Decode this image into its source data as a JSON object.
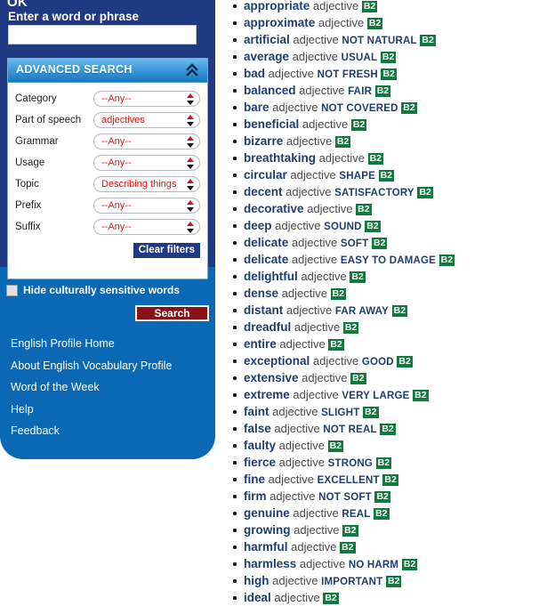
{
  "sidebar": {
    "ok_text": "OK",
    "search_label": "Enter a word or phrase",
    "word_input_value": "",
    "word_input_placeholder": "",
    "advanced_search": {
      "title": "ADVANCED SEARCH",
      "collapse_icon": "double-chevron-up-icon",
      "filters": [
        {
          "label": "Category",
          "value": "--Any--"
        },
        {
          "label": "Part of speech",
          "value": "adjectives"
        },
        {
          "label": "Grammar",
          "value": "--Any--"
        },
        {
          "label": "Usage",
          "value": "--Any--"
        },
        {
          "label": "Topic",
          "value": "Describing things"
        },
        {
          "label": "Prefix",
          "value": "--Any--"
        },
        {
          "label": "Suffix",
          "value": "--Any--"
        }
      ],
      "clear_filters_label": "Clear filters"
    },
    "hide_sensitive_label": "Hide culturally sensitive words",
    "hide_sensitive_checked": false,
    "search_button_label": "Search",
    "nav_links": [
      "English Profile Home",
      "About English Vocabulary Profile",
      "Word of the Week",
      "Help",
      "Feedback"
    ]
  },
  "colors": {
    "sidebar_top": "#1f3a82",
    "sidebar_bottom": "#0a68b4",
    "level_badge_green": "#11793d",
    "search_button_red": "#8b1116",
    "select_text_red": "#ee1111",
    "word_navy": "#1f3d70"
  },
  "results": {
    "entries": [
      {
        "word": "appropriate",
        "pos": "adjective",
        "sense": "",
        "level": "B2"
      },
      {
        "word": "approximate",
        "pos": "adjective",
        "sense": "",
        "level": "B2"
      },
      {
        "word": "artificial",
        "pos": "adjective",
        "sense": "NOT NATURAL",
        "level": "B2"
      },
      {
        "word": "average",
        "pos": "adjective",
        "sense": "USUAL",
        "level": "B2"
      },
      {
        "word": "bad",
        "pos": "adjective",
        "sense": "NOT FRESH",
        "level": "B2"
      },
      {
        "word": "balanced",
        "pos": "adjective",
        "sense": "FAIR",
        "level": "B2"
      },
      {
        "word": "bare",
        "pos": "adjective",
        "sense": "NOT COVERED",
        "level": "B2"
      },
      {
        "word": "beneficial",
        "pos": "adjective",
        "sense": "",
        "level": "B2"
      },
      {
        "word": "bizarre",
        "pos": "adjective",
        "sense": "",
        "level": "B2"
      },
      {
        "word": "breathtaking",
        "pos": "adjective",
        "sense": "",
        "level": "B2"
      },
      {
        "word": "circular",
        "pos": "adjective",
        "sense": "SHAPE",
        "level": "B2"
      },
      {
        "word": "decent",
        "pos": "adjective",
        "sense": "SATISFACTORY",
        "level": "B2"
      },
      {
        "word": "decorative",
        "pos": "adjective",
        "sense": "",
        "level": "B2"
      },
      {
        "word": "deep",
        "pos": "adjective",
        "sense": "SOUND",
        "level": "B2"
      },
      {
        "word": "delicate",
        "pos": "adjective",
        "sense": "SOFT",
        "level": "B2"
      },
      {
        "word": "delicate",
        "pos": "adjective",
        "sense": "EASY TO DAMAGE",
        "level": "B2"
      },
      {
        "word": "delightful",
        "pos": "adjective",
        "sense": "",
        "level": "B2"
      },
      {
        "word": "dense",
        "pos": "adjective",
        "sense": "",
        "level": "B2"
      },
      {
        "word": "distant",
        "pos": "adjective",
        "sense": "FAR AWAY",
        "level": "B2"
      },
      {
        "word": "dreadful",
        "pos": "adjective",
        "sense": "",
        "level": "B2"
      },
      {
        "word": "entire",
        "pos": "adjective",
        "sense": "",
        "level": "B2"
      },
      {
        "word": "exceptional",
        "pos": "adjective",
        "sense": "GOOD",
        "level": "B2"
      },
      {
        "word": "extensive",
        "pos": "adjective",
        "sense": "",
        "level": "B2"
      },
      {
        "word": "extreme",
        "pos": "adjective",
        "sense": "VERY LARGE",
        "level": "B2"
      },
      {
        "word": "faint",
        "pos": "adjective",
        "sense": "SLIGHT",
        "level": "B2"
      },
      {
        "word": "false",
        "pos": "adjective",
        "sense": "NOT REAL",
        "level": "B2"
      },
      {
        "word": "faulty",
        "pos": "adjective",
        "sense": "",
        "level": "B2"
      },
      {
        "word": "fierce",
        "pos": "adjective",
        "sense": "STRONG",
        "level": "B2"
      },
      {
        "word": "fine",
        "pos": "adjective",
        "sense": "EXCELLENT",
        "level": "B2"
      },
      {
        "word": "firm",
        "pos": "adjective",
        "sense": "NOT SOFT",
        "level": "B2"
      },
      {
        "word": "genuine",
        "pos": "adjective",
        "sense": "REAL",
        "level": "B2"
      },
      {
        "word": "growing",
        "pos": "adjective",
        "sense": "",
        "level": "B2"
      },
      {
        "word": "harmful",
        "pos": "adjective",
        "sense": "",
        "level": "B2"
      },
      {
        "word": "harmless",
        "pos": "adjective",
        "sense": "NO HARM",
        "level": "B2"
      },
      {
        "word": "high",
        "pos": "adjective",
        "sense": "IMPORTANT",
        "level": "B2"
      },
      {
        "word": "ideal",
        "pos": "adjective",
        "sense": "",
        "level": "B2"
      }
    ]
  }
}
